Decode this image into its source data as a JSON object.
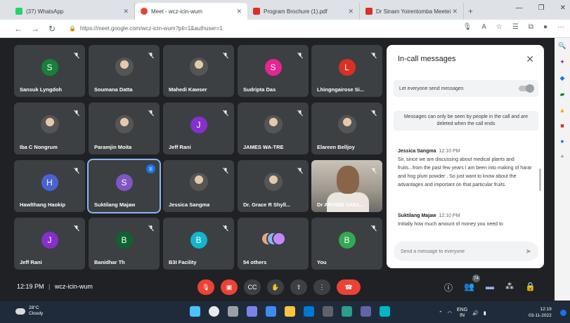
{
  "browser": {
    "tabs": [
      {
        "title": "(37) WhatsApp",
        "color": "#25d366"
      },
      {
        "title": "Meet - wcz-icin-wum",
        "color": "#ea4335"
      },
      {
        "title": "Program Brochure (1).pdf",
        "color": "#d93025"
      },
      {
        "title": "Dr Sinam Yoirentomba Meetei",
        "color": "#d93025"
      }
    ],
    "url": "https://meet.google.com/wcz-icin-wum?pli=1&authuser=1"
  },
  "participants": [
    {
      "name": "Sansuk Lyngdoh",
      "initial": "S",
      "color": "#188038",
      "kind": "avatar"
    },
    {
      "name": "Soumana Datta",
      "initial": "",
      "color": "",
      "kind": "photo"
    },
    {
      "name": "Mahedi Kawser",
      "initial": "",
      "color": "",
      "kind": "photo"
    },
    {
      "name": "Sudripta Das",
      "initial": "S",
      "color": "#e52592",
      "kind": "avatar"
    },
    {
      "name": "Lhingngairose Si...",
      "initial": "L",
      "color": "#d93025",
      "kind": "avatar"
    },
    {
      "name": "Iba C Nongrum",
      "initial": "",
      "color": "",
      "kind": "photo"
    },
    {
      "name": "Paramjin Moita",
      "initial": "",
      "color": "",
      "kind": "photo"
    },
    {
      "name": "Jeff Rani",
      "initial": "J",
      "color": "#8430ce",
      "kind": "avatar"
    },
    {
      "name": "JAMES WA-TRE",
      "initial": "",
      "color": "",
      "kind": "photo"
    },
    {
      "name": "Elareen Belljoy",
      "initial": "",
      "color": "",
      "kind": "photo"
    },
    {
      "name": "Hawlthang Haokip",
      "initial": "H",
      "color": "#4a63d1",
      "kind": "avatar"
    },
    {
      "name": "Suktilang Majaw",
      "initial": "S",
      "color": "#7e57c2",
      "kind": "speaking"
    },
    {
      "name": "Jessica Sangma",
      "initial": "",
      "color": "",
      "kind": "photo"
    },
    {
      "name": "Dr. Grace R Shyll...",
      "initial": "",
      "color": "",
      "kind": "photo"
    },
    {
      "name": "Dr ARVIND SAKL...",
      "initial": "",
      "color": "",
      "kind": "video"
    },
    {
      "name": "Jeff Rani",
      "initial": "J",
      "color": "#8430ce",
      "kind": "avatar"
    },
    {
      "name": "Banidhar Th",
      "initial": "B",
      "color": "#0d652d",
      "kind": "avatar"
    },
    {
      "name": "B3I Facility",
      "initial": "B",
      "color": "#12b5cb",
      "kind": "avatar"
    },
    {
      "name": "54 others",
      "initial": "",
      "color": "",
      "kind": "others"
    },
    {
      "name": "You",
      "initial": "B",
      "color": "#34a853",
      "kind": "avatar"
    }
  ],
  "chat": {
    "title": "In-call messages",
    "setting_label": "Let everyone send messages",
    "notice": "Messages can only be seen by people in the call and are deleted when the call ends",
    "messages": [
      {
        "sender": "Jessica Sangma",
        "time": "12:10 PM",
        "text": "Sir, since we are discussing about medical plants and fruits...from the past few years I am been into making of harar and hog plum powder . So just want to know about the advantages and important  on that particular fruits."
      },
      {
        "sender": "Suktilang Majaw",
        "time": "12:10 PM",
        "text": "Initially how much amount of money you need to"
      }
    ],
    "input_placeholder": "Send a message to everyone"
  },
  "meeting": {
    "time": "12:19 PM",
    "separator": "|",
    "code": "wcz-icin-wum",
    "participant_count": "74"
  },
  "taskbar": {
    "temp": "28°C",
    "weather": "Cloudy",
    "lang": "ENG",
    "region": "IN",
    "clock_time": "12:19",
    "clock_date": "03-11-2022"
  }
}
